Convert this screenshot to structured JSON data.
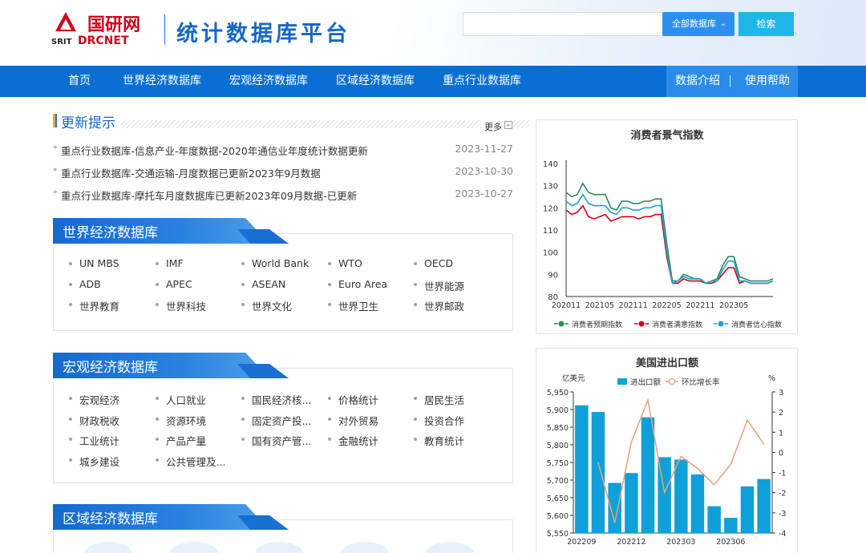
{
  "header": {
    "logo_top_text": "国研网",
    "logo_left_text": "SRIT",
    "logo_right_text": "DRCNET",
    "site_title": "统计数据库平台",
    "search_placeholder": "",
    "search_scope": "全部数据库",
    "search_button": "检索"
  },
  "nav": {
    "items": [
      "首页",
      "世界经济数据库",
      "宏观经济数据库",
      "区域经济数据库",
      "重点行业数据库"
    ],
    "right_items": [
      "数据介绍",
      "使用帮助"
    ]
  },
  "updates": {
    "title": "更新提示",
    "more": "更多",
    "rows": [
      {
        "text": "重点行业数据库-信息产业-年度数据-2020年通信业年度统计数据更新",
        "date": "2023-11-27"
      },
      {
        "text": "重点行业数据库-交通运输-月度数据已更新2023年9月数据",
        "date": "2023-10-30"
      },
      {
        "text": "重点行业数据库-摩托车月度数据库已更新2023年09月数据-已更新",
        "date": "2023-10-27"
      }
    ]
  },
  "sections": [
    {
      "title": "世界经济数据库",
      "items": [
        "UN MBS",
        "IMF",
        "World Bank",
        "WTO",
        "OECD",
        "ADB",
        "APEC",
        "ASEAN",
        "Euro Area",
        "世界能源",
        "世界教育",
        "世界科技",
        "世界文化",
        "世界卫生",
        "世界邮政"
      ]
    },
    {
      "title": "宏观经济数据库",
      "items": [
        "宏观经济",
        "人口就业",
        "国民经济核...",
        "价格统计",
        "居民生活",
        "财政税收",
        "资源环境",
        "固定资产投...",
        "对外贸易",
        "投资合作",
        "工业统计",
        "产品产量",
        "国有资产管...",
        "金融统计",
        "教育统计",
        "城乡建设",
        "公共管理及..."
      ]
    },
    {
      "title": "区域经济数据库",
      "items": []
    }
  ],
  "chart_data": [
    {
      "type": "line",
      "title": "消费者景气指数",
      "x_ticks": [
        "202011",
        "202105",
        "202111",
        "202205",
        "202211",
        "202305"
      ],
      "ylim": [
        80,
        140
      ],
      "y_ticks": [
        80,
        90,
        100,
        110,
        120,
        130,
        140
      ],
      "grid": false,
      "legend_position": "bottom",
      "colors": {
        "预期": "#2e8b57",
        "满意": "#d0021b",
        "信心": "#1fa3cf"
      },
      "series": [
        {
          "name": "消费者预期指数",
          "color": "#2e8b57",
          "values": [
            127,
            125,
            126,
            131,
            127,
            126,
            126,
            126,
            120,
            119,
            123,
            123,
            122,
            122,
            123,
            123,
            124,
            124,
            104,
            87,
            87,
            90,
            89,
            88,
            88,
            86,
            87,
            88,
            94,
            98,
            98,
            89,
            88,
            87,
            87,
            87,
            87,
            88
          ]
        },
        {
          "name": "消费者满意指数",
          "color": "#d0021b",
          "values": [
            119,
            117,
            118,
            121,
            116,
            115,
            116,
            117,
            114,
            115,
            116,
            116,
            116,
            115,
            116,
            116,
            117,
            117,
            98,
            86,
            86,
            88,
            87,
            87,
            87,
            86,
            86,
            87,
            90,
            93,
            93,
            86,
            87,
            86,
            86,
            86,
            86,
            87
          ]
        },
        {
          "name": "消费者信心指数",
          "color": "#1fa3cf",
          "values": [
            123,
            121,
            122,
            126,
            122,
            121,
            121,
            121,
            118,
            117,
            120,
            120,
            119,
            119,
            120,
            120,
            121,
            121,
            100,
            86,
            87,
            89,
            88,
            88,
            88,
            86,
            87,
            87,
            92,
            96,
            96,
            87,
            87,
            86,
            86,
            86,
            86,
            87
          ]
        }
      ]
    },
    {
      "type": "bar",
      "title": "美国进出口额",
      "categories": [
        "202209",
        "202210",
        "202211",
        "202212",
        "202301",
        "202302",
        "202303",
        "202304",
        "202305",
        "202306",
        "202307",
        "202308"
      ],
      "x_ticks": [
        "202209",
        "202212",
        "202303",
        "202306"
      ],
      "left_axis_label": "亿美元",
      "right_axis_label": "%",
      "ylim": [
        5550,
        5950
      ],
      "y_ticks": [
        5550,
        5600,
        5650,
        5700,
        5750,
        5800,
        5850,
        5900,
        5950
      ],
      "y2lim": [
        -4,
        3
      ],
      "y2_ticks": [
        -4,
        -3,
        -2,
        -1,
        0,
        1,
        2,
        3
      ],
      "legend_position": "top",
      "series": [
        {
          "name": "进出口额",
          "type": "bar",
          "color": "#0fa0d8",
          "values": [
            5912,
            5893,
            5692,
            5720,
            5878,
            5765,
            5758,
            5716,
            5626,
            5593,
            5682,
            5703
          ]
        },
        {
          "name": "环比增长率",
          "type": "line",
          "color": "#e8a07c",
          "values": [
            null,
            -0.5,
            -3.5,
            0.5,
            2.6,
            -2.0,
            -0.2,
            -0.8,
            -1.6,
            -0.6,
            1.6,
            0.4
          ]
        }
      ]
    }
  ]
}
